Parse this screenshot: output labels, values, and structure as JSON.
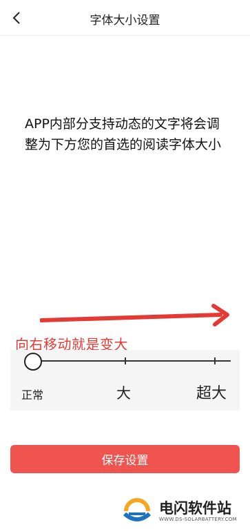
{
  "header": {
    "title": "字体大小设置",
    "back_icon": "chevron-left-icon"
  },
  "preview": {
    "text": "APP内部分支持动态的文字将会调整为下方您的首选的阅读字体大小"
  },
  "annotation": {
    "hint": "向右移动就是变大",
    "arrow_icon": "arrow-right-icon",
    "color": "#e53935"
  },
  "font_slider": {
    "labels": [
      "正常",
      "大",
      "超大"
    ],
    "selected": "正常",
    "selected_index": 0
  },
  "actions": {
    "save_label": "保存设置",
    "save_color": "#f0544f"
  },
  "watermark": {
    "name": "电闪软件站",
    "url": "WWW.DS-SOLARBATTERY.COM"
  }
}
